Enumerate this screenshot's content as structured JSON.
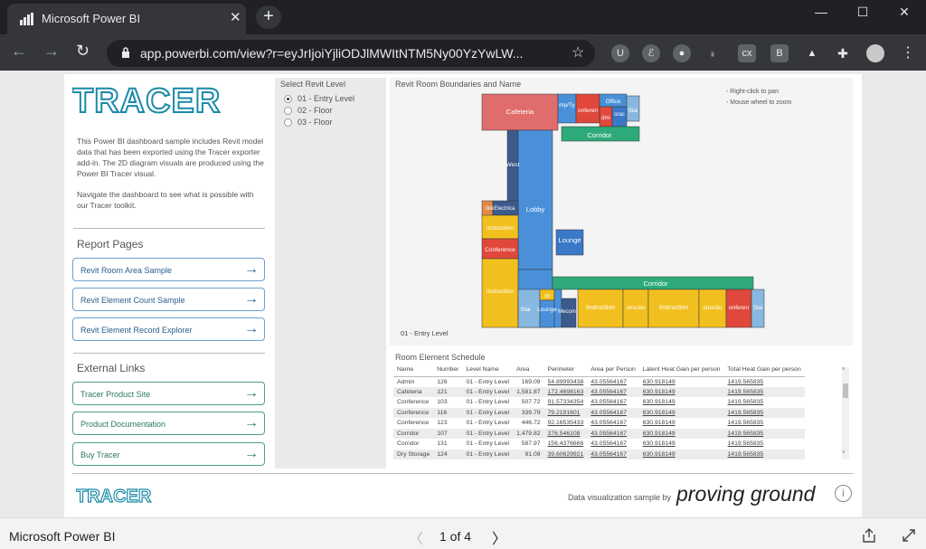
{
  "browser": {
    "tab_title": "Microsoft Power BI",
    "url": "app.powerbi.com/view?r=eyJrIjoiYjliODJlMWItNTM5Ny00YzYwLW...",
    "win_minimize": "—",
    "win_maximize": "☐",
    "win_close": "✕"
  },
  "left": {
    "logo_text": "TRACER",
    "description_p1": "This Power BI dashboard sample includes Revit model data that has been exported using the Tracer exporter add-in. The 2D diagram visuals are produced using the Power BI Tracer visual.",
    "description_p2": "Navigate the dashboard to see what is possible with our Tracer toolkit.",
    "report_pages_title": "Report Pages",
    "report_pages": [
      "Revit Room Area Sample",
      "Revit Element Count Sample",
      "Revit Element Record Explorer"
    ],
    "external_links_title": "External Links",
    "external_links": [
      "Tracer Product Site",
      "Product Documentation",
      "Buy Tracer"
    ]
  },
  "slicer": {
    "title": "Select Revit Level",
    "options": [
      "01 - Entry Level",
      "02 - Floor",
      "03 - Floor"
    ],
    "selected": "01 - Entry Level"
  },
  "map": {
    "title": "Revit Room Boundaries and Name",
    "hint1": "- Right-click to pan",
    "hint2": "- Mouse wheel to zoom",
    "level_label": "01 - Entry Level",
    "rooms": [
      "Cafeteria",
      "mp/Ty",
      "onferen",
      "Office",
      "orac",
      "dmi",
      "Stai",
      "Corridor",
      "West",
      "Lobby",
      "rinkElectrica",
      "Instruction",
      "Conference",
      "Lounge",
      "Instruction",
      "ctr",
      "Stai",
      "Lounge",
      "Mecom",
      "Corridor",
      "Instruction",
      "structio",
      "Instruction",
      "structio",
      "onferen",
      "Stai"
    ]
  },
  "schedule": {
    "title": "Room Element Schedule",
    "columns": [
      "Name",
      "Number",
      "Level Name",
      "Area",
      "Perimeter",
      "Area per Person",
      "Latent Heat Gain per person",
      "Total Heat Gain per person"
    ],
    "rows": [
      [
        "Admin",
        "126",
        "01 - Entry Level",
        "169.09",
        "54.89993438",
        "43.05564167",
        "630.918149",
        "1419.565835"
      ],
      [
        "Cafeteria",
        "121",
        "01 - Entry Level",
        "1,581.87",
        "172.4698163",
        "43.05564167",
        "630.918149",
        "1419.565835"
      ],
      [
        "Conference",
        "103",
        "01 - Entry Level",
        "507.72",
        "91.57334354",
        "43.05564167",
        "630.918149",
        "1419.565835"
      ],
      [
        "Conference",
        "116",
        "01 - Entry Level",
        "339.79",
        "79.2191601",
        "43.05564167",
        "630.918149",
        "1419.565835"
      ],
      [
        "Conference",
        "123",
        "01 - Entry Level",
        "446.72",
        "92.16535433",
        "43.05564167",
        "630.918149",
        "1419.565835"
      ],
      [
        "Corridor",
        "107",
        "01 - Entry Level",
        "1,479.82",
        "376.546108",
        "43.05564167",
        "630.918149",
        "1419.565835"
      ],
      [
        "Corridor",
        "131",
        "01 - Entry Level",
        "587.97",
        "156.4376666",
        "43.05564167",
        "630.918149",
        "1419.565835"
      ],
      [
        "Dry Storage",
        "124",
        "01 - Entry Level",
        "91.09",
        "39.60629921",
        "43.05564167",
        "630.918149",
        "1419.565835"
      ]
    ]
  },
  "footer": {
    "logo_text": "TRACER",
    "sample_by": "Data visualization sample by",
    "brand": "proving ground",
    "info": "i"
  },
  "bottombar": {
    "app_name": "Microsoft Power BI",
    "page_indicator": "1 of 4",
    "prev": "〈",
    "next": "〉"
  },
  "colors": {
    "cafeteria": "#e06c6c",
    "corridor": "#2eaa7a",
    "lobby": "#4a90d9",
    "instruction": "#f2c01e",
    "conference": "#e0483c",
    "lounge": "#3a78c8",
    "office": "#4a90d9",
    "west": "#3c5a8c"
  }
}
